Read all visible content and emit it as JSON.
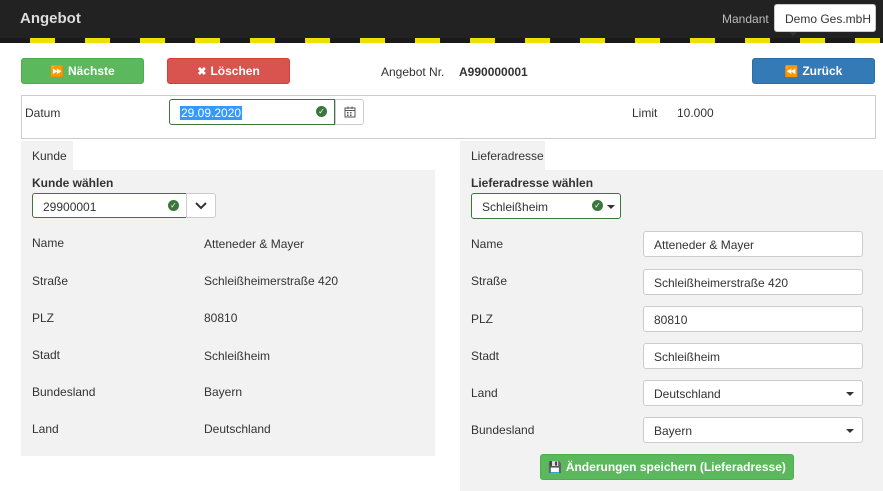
{
  "header": {
    "title": "Angebot",
    "mandant_label": "Mandant",
    "mandant_value": "Demo Ges.mbH"
  },
  "actions": {
    "next_label": "Nächste",
    "delete_label": "Löschen",
    "back_label": "Zurück",
    "offer_nr_label": "Angebot Nr.",
    "offer_nr_value": "A990000001"
  },
  "date_row": {
    "date_label": "Datum",
    "date_value": "29.09.2020",
    "limit_label": "Limit",
    "limit_value": "10.000"
  },
  "customer": {
    "tab_label": "Kunde",
    "select_label": "Kunde wählen",
    "select_value": "29900001",
    "fields": [
      {
        "label": "Name",
        "value": "Atteneder & Mayer"
      },
      {
        "label": "Straße",
        "value": "Schleißheimerstraße 420"
      },
      {
        "label": "PLZ",
        "value": "80810"
      },
      {
        "label": "Stadt",
        "value": "Schleißheim"
      },
      {
        "label": "Bundesland",
        "value": "Bayern"
      },
      {
        "label": "Land",
        "value": "Deutschland"
      }
    ]
  },
  "delivery": {
    "tab_label": "Lieferadresse",
    "select_label": "Lieferadresse wählen",
    "select_value": "Schleißheim",
    "fields": [
      {
        "label": "Name",
        "value": "Atteneder & Mayer"
      },
      {
        "label": "Straße",
        "value": "Schleißheimerstraße 420"
      },
      {
        "label": "PLZ",
        "value": "80810"
      },
      {
        "label": "Stadt",
        "value": "Schleißheim"
      },
      {
        "label": "Land",
        "value": "Deutschland"
      },
      {
        "label": "Bundesland",
        "value": "Bayern"
      }
    ],
    "save_label": "Änderungen speichern (Lieferadresse)"
  },
  "colors": {
    "success": "#5cb85c",
    "danger": "#d9534f",
    "primary": "#337ab7",
    "navbar": "#222222",
    "stripe_yellow": "#f0e000"
  },
  "icons": {
    "next": "fast-forward-icon",
    "delete": "times-icon",
    "back": "fast-backward-icon",
    "calendar": "calendar-icon",
    "valid": "check-circle-icon",
    "save": "floppy-disk-icon"
  }
}
